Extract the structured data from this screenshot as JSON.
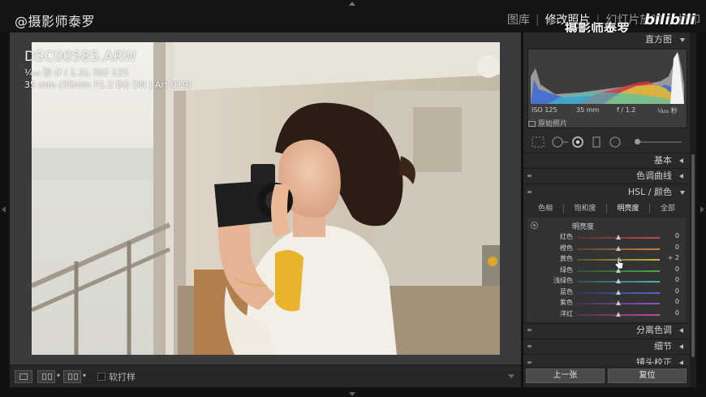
{
  "brand": "@摄影师泰罗",
  "watermark": "摄影师泰罗",
  "bili_logo": "bilibili",
  "modules": [
    "图库",
    "修改照片",
    "幻灯片放映",
    "打印"
  ],
  "active_module": 1,
  "photo_info": {
    "filename": "DSC00585.ARW",
    "exposure": "¹⁄₄₀₀ 秒 (f / 1.2), ISO 125",
    "lens": "35 mm (35mm F1.2 DG DN | Art 019)"
  },
  "histogram": {
    "title": "直方图",
    "iso": "ISO 125",
    "focal": "35 mm",
    "aperture": "f / 1.2",
    "shutter": "¹⁄₄₀₀ 秒",
    "original_label": "原始照片"
  },
  "panels": {
    "basic": "基本",
    "tone_curve": "色调曲线",
    "hsl": "HSL / 颜色",
    "split_toning": "分离色调",
    "detail": "细节",
    "lens": "镜头校正"
  },
  "hsl_tabs": [
    "色相",
    "饱和度",
    "明亮度",
    "全部"
  ],
  "hsl_active_tab": 2,
  "luminance_title": "明亮度",
  "luminance_sliders": [
    {
      "label": "红色",
      "value": "0",
      "num": 0
    },
    {
      "label": "橙色",
      "value": "0",
      "num": 0
    },
    {
      "label": "黄色",
      "value": "+ 2",
      "num": 2
    },
    {
      "label": "绿色",
      "value": "0",
      "num": 0
    },
    {
      "label": "浅绿色",
      "value": "0",
      "num": 0
    },
    {
      "label": "蓝色",
      "value": "0",
      "num": 0
    },
    {
      "label": "紫色",
      "value": "0",
      "num": 0
    },
    {
      "label": "洋红",
      "value": "0",
      "num": 0
    }
  ],
  "slider_range": [
    -100,
    100
  ],
  "toolbar": {
    "soft_proof": "软打样"
  },
  "buttons": {
    "previous": "上一张",
    "reset": "复位"
  },
  "colors": {
    "accent": "#f0f0f0",
    "panel_bg": "#2a2a2a"
  }
}
